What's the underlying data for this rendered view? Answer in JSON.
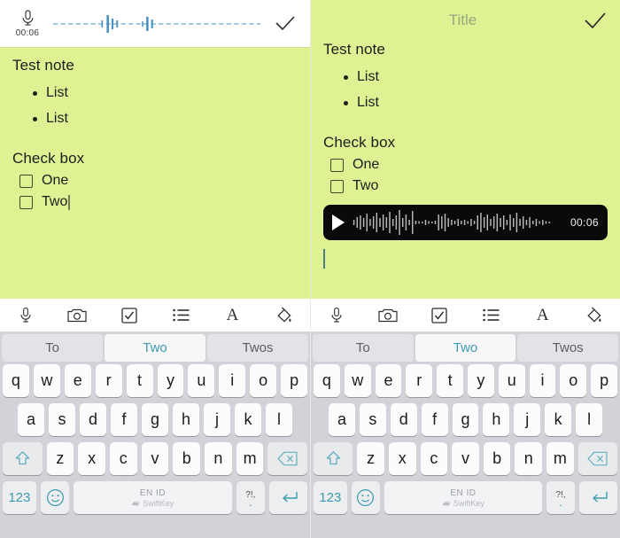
{
  "app": {
    "background_color": "#dcf293",
    "accent_color": "#3d9cb0"
  },
  "left_panel": {
    "recording_bar": {
      "mic_icon": "microphone-icon",
      "elapsed": "00:06",
      "waveform_color": "#4a90c2",
      "confirm_icon": "checkmark-icon"
    },
    "note": {
      "heading": "Test note",
      "bullets": [
        "List",
        "List"
      ],
      "checkbox_heading": "Check box",
      "checkboxes": [
        {
          "label": "One",
          "checked": false
        },
        {
          "label": "Two",
          "checked": false
        }
      ]
    }
  },
  "right_panel": {
    "title_bar": {
      "placeholder": "Title",
      "confirm_icon": "checkmark-icon"
    },
    "note": {
      "heading": "Test note",
      "bullets": [
        "List",
        "List"
      ],
      "checkbox_heading": "Check box",
      "checkboxes": [
        {
          "label": "One",
          "checked": false
        },
        {
          "label": "Two",
          "checked": false
        }
      ]
    },
    "audio_attachment": {
      "play_icon": "play-icon",
      "duration": "00:06",
      "background": "#0a0a0a",
      "waveform_color": "#b9b9b9"
    }
  },
  "format_toolbar": {
    "items": [
      {
        "name": "microphone-icon",
        "label": "Record audio"
      },
      {
        "name": "camera-icon",
        "label": "Camera"
      },
      {
        "name": "checkbox-icon",
        "label": "Checklist"
      },
      {
        "name": "list-icon",
        "label": "Bullet list"
      },
      {
        "name": "text-format-icon",
        "label": "A"
      },
      {
        "name": "paint-bucket-icon",
        "label": "Fill color"
      }
    ]
  },
  "keyboard": {
    "predictions": [
      {
        "text": "To",
        "active": false
      },
      {
        "text": "Two",
        "active": true
      },
      {
        "text": "Twos",
        "active": false
      }
    ],
    "row1": [
      "q",
      "w",
      "e",
      "r",
      "t",
      "y",
      "u",
      "i",
      "o",
      "p"
    ],
    "row2": [
      "a",
      "s",
      "d",
      "f",
      "g",
      "h",
      "j",
      "k",
      "l"
    ],
    "row3": [
      "z",
      "x",
      "c",
      "v",
      "b",
      "n",
      "m"
    ],
    "shift_icon": "shift-icon",
    "backspace_icon": "backspace-icon",
    "numeric_key": "123",
    "emoji_icon": "emoji-icon",
    "space_language": "EN ID",
    "space_brand": "SwiftKey",
    "punct_top": "?!,",
    "punct_bottom": ".",
    "enter_icon": "return-icon"
  }
}
